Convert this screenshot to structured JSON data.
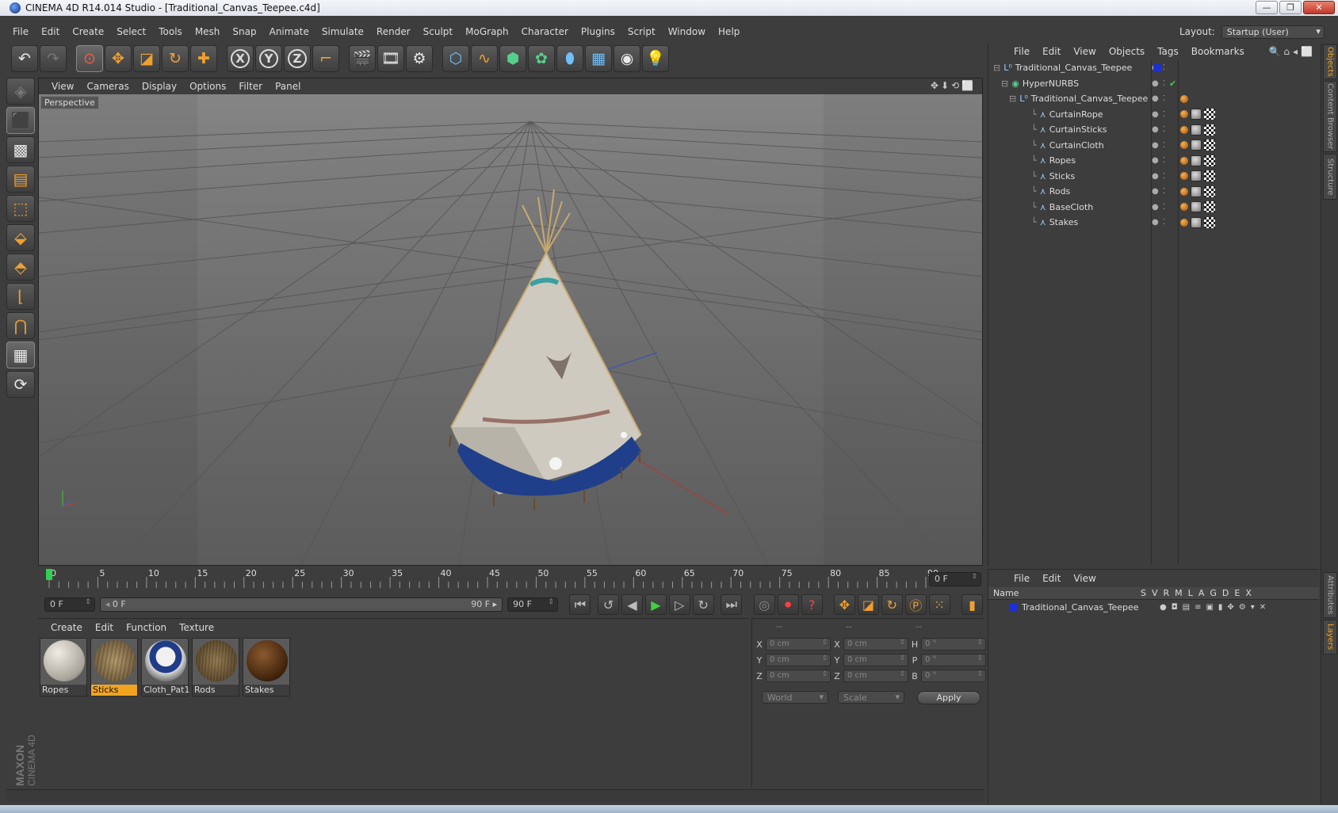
{
  "window": {
    "title": "CINEMA 4D R14.014 Studio - [Traditional_Canvas_Teepee.c4d]"
  },
  "menubar": [
    "File",
    "Edit",
    "Create",
    "Select",
    "Tools",
    "Mesh",
    "Snap",
    "Animate",
    "Simulate",
    "Render",
    "Sculpt",
    "MoGraph",
    "Character",
    "Plugins",
    "Script",
    "Window",
    "Help"
  ],
  "layout": {
    "label": "Layout:",
    "value": "Startup (User)"
  },
  "viewport": {
    "menu": [
      "View",
      "Cameras",
      "Display",
      "Options",
      "Filter",
      "Panel"
    ],
    "label": "Perspective"
  },
  "timeline": {
    "ticks": [
      "0",
      "5",
      "10",
      "15",
      "20",
      "25",
      "30",
      "35",
      "40",
      "45",
      "50",
      "55",
      "60",
      "65",
      "70",
      "75",
      "80",
      "85",
      "90"
    ],
    "current_frame": "0 F"
  },
  "transport": {
    "start": "0 F",
    "range_start": "0 F",
    "range_end": "90 F",
    "end": "90 F"
  },
  "materials": {
    "menu": [
      "Create",
      "Edit",
      "Function",
      "Texture"
    ],
    "items": [
      {
        "name": "Ropes",
        "active": false
      },
      {
        "name": "Sticks",
        "active": true
      },
      {
        "name": "Cloth_Pat1",
        "active": false
      },
      {
        "name": "Rods",
        "active": false
      },
      {
        "name": "Stakes",
        "active": false
      }
    ]
  },
  "coordinates": {
    "headers": [
      "--",
      "--",
      "--"
    ],
    "rows": [
      {
        "a": "X",
        "av": "0 cm",
        "b": "X",
        "bv": "0 cm",
        "c": "H",
        "cv": "0 °"
      },
      {
        "a": "Y",
        "av": "0 cm",
        "b": "Y",
        "bv": "0 cm",
        "c": "P",
        "cv": "0 °"
      },
      {
        "a": "Z",
        "av": "0 cm",
        "b": "Z",
        "bv": "0 cm",
        "c": "B",
        "cv": "0 °"
      }
    ],
    "mode": "World",
    "scale": "Scale",
    "apply": "Apply"
  },
  "objects": {
    "menu": [
      "File",
      "Edit",
      "View",
      "Objects",
      "Tags",
      "Bookmarks"
    ],
    "items": [
      {
        "name": "Traditional_Canvas_Teepee",
        "level": 0,
        "kind": "null"
      },
      {
        "name": "HyperNURBS",
        "level": 1,
        "kind": "nurbs"
      },
      {
        "name": "Traditional_Canvas_Teepee",
        "level": 2,
        "kind": "null"
      },
      {
        "name": "CurtainRope",
        "level": 3,
        "kind": "poly"
      },
      {
        "name": "CurtainSticks",
        "level": 3,
        "kind": "poly"
      },
      {
        "name": "CurtainCloth",
        "level": 3,
        "kind": "poly"
      },
      {
        "name": "Ropes",
        "level": 3,
        "kind": "poly"
      },
      {
        "name": "Sticks",
        "level": 3,
        "kind": "poly"
      },
      {
        "name": "Rods",
        "level": 3,
        "kind": "poly"
      },
      {
        "name": "BaseCloth",
        "level": 3,
        "kind": "poly"
      },
      {
        "name": "Stakes",
        "level": 3,
        "kind": "poly"
      }
    ]
  },
  "side_tabs": [
    "Objects",
    "Content Browser",
    "Structure",
    "Attributes",
    "Layers"
  ],
  "layers": {
    "menu": [
      "File",
      "Edit",
      "View"
    ],
    "columns": [
      "S",
      "V",
      "R",
      "M",
      "L",
      "A",
      "G",
      "D",
      "E",
      "X"
    ],
    "name_header": "Name",
    "items": [
      {
        "name": "Traditional_Canvas_Teepee",
        "color": "#1b2fd8"
      }
    ]
  },
  "brand": {
    "line1": "MAXON",
    "line2": "CINEMA 4D"
  },
  "colors": {
    "accent": "#f3a41f",
    "background": "#3d3d3d",
    "layer_blue": "#1b2fd8"
  }
}
